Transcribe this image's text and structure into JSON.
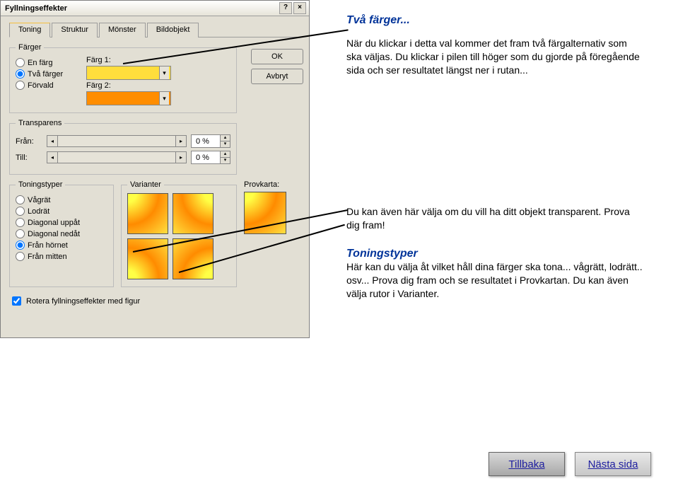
{
  "dialog": {
    "title": "Fyllningseffekter",
    "tabs": [
      "Toning",
      "Struktur",
      "Mönster",
      "Bildobjekt"
    ],
    "active_tab": 0,
    "ok": "OK",
    "cancel": "Avbryt",
    "groups": {
      "farger": {
        "legend": "Färger",
        "radios": [
          "En färg",
          "Två färger",
          "Förvald"
        ],
        "selected": 1,
        "color1_label": "Färg 1:",
        "color1_hex": "#ffde3c",
        "color2_label": "Färg 2:",
        "color2_hex": "#ff8d00"
      },
      "transparens": {
        "legend": "Transparens",
        "from_label": "Från:",
        "to_label": "Till:",
        "from_value": "0 %",
        "to_value": "0 %"
      },
      "toningstyper": {
        "legend": "Toningstyper",
        "radios": [
          "Vågrät",
          "Lodrät",
          "Diagonal uppåt",
          "Diagonal nedåt",
          "Från hörnet",
          "Från mitten"
        ],
        "selected": 4
      },
      "varianter": {
        "legend": "Varianter"
      },
      "provkarta_label": "Provkarta:",
      "rotate_checkbox": "Rotera fyllningseffekter med figur",
      "rotate_checked": true
    }
  },
  "explain": {
    "title": "Två färger...",
    "p1": "När du klickar i detta val kommer det fram två färgalternativ som ska väljas. Du klickar i pilen till höger som du gjorde på föregående sida och ser resultatet längst ner i rutan...",
    "p2": "Du kan även här välja om du vill ha ditt objekt transparent. Prova dig fram!",
    "sub": "Toningstyper",
    "p3": "Här kan du välja åt vilket håll dina färger ska tona... vågrätt, lodrätt.. osv... Prova dig fram och se resultatet i Provkartan. Du kan även välja rutor i Varianter."
  },
  "nav": {
    "prev": "Tillbaka",
    "next": "Nästa sida"
  }
}
